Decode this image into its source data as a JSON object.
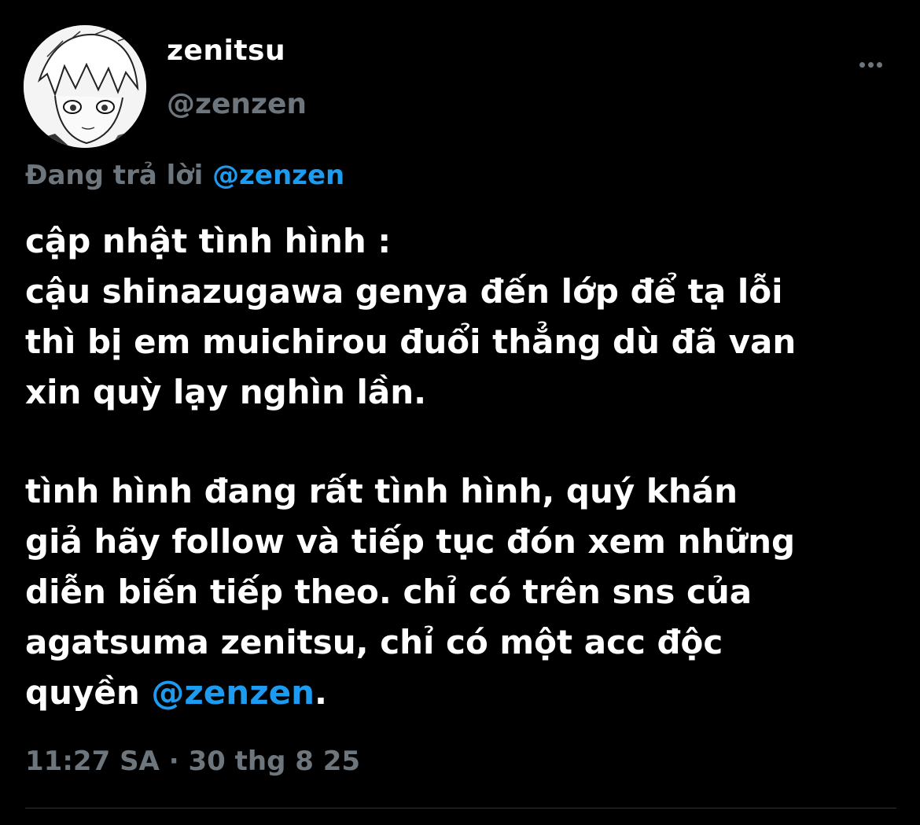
{
  "author": {
    "display_name": "zenitsu",
    "handle": "@zenzen",
    "avatar": "manga-style character portrait"
  },
  "more_icon": "more-horizontal-icon",
  "reply": {
    "prefix": "Đang trả lời ",
    "mention": "@zenzen"
  },
  "tweet": {
    "lines": [
      "cập nhật tình hình :",
      "cậu shinazugawa genya đến lớp để tạ lỗi",
      "thì bị em muichirou đuổi thẳng dù đã van",
      "xin quỳ lạy nghìn lần.",
      "tình hình đang rất tình hình, quý khán",
      "giả hãy follow và tiếp tục đón xem những",
      "diễn biến tiếp theo. chỉ có trên sns của",
      "agatsuma zenitsu, chỉ có một acc độc"
    ],
    "last_line_prefix": "quyền ",
    "last_line_mention": "@zenzen",
    "last_line_suffix": "."
  },
  "meta": {
    "time": "11:27 SA",
    "separator": " · ",
    "date": "30 thg 8 25"
  },
  "colors": {
    "background": "#000000",
    "text": "#ffffff",
    "secondary": "#6e767d",
    "link": "#1d9bf0",
    "divider": "#2f3336"
  }
}
